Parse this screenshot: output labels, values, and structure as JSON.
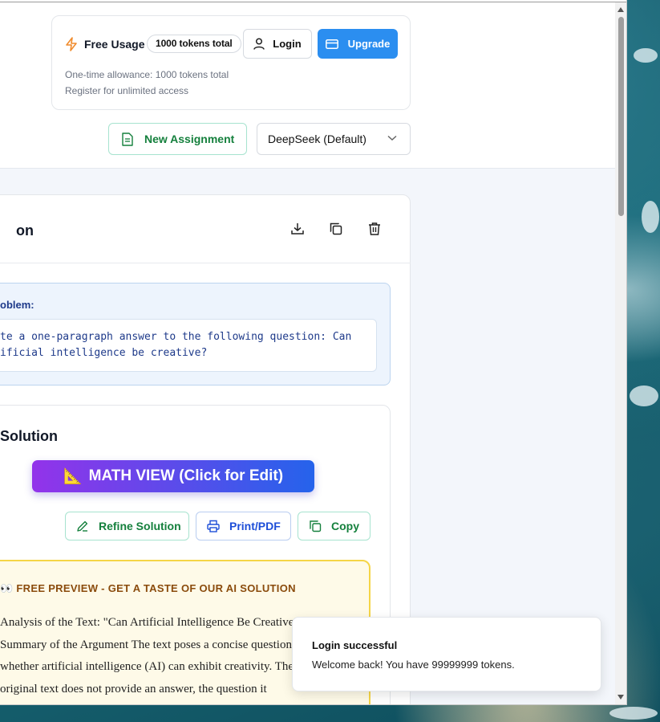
{
  "usage": {
    "title": "Free Usage",
    "token_pill": "1000 tokens total",
    "login_label": "Login",
    "upgrade_label": "Upgrade",
    "allowance_line": "One-time allowance: 1000 tokens total",
    "register_line": "Register for unlimited access"
  },
  "toolbar": {
    "new_assignment_label": "New Assignment",
    "model_selected": "DeepSeek (Default)"
  },
  "card": {
    "title_fragment": "on",
    "problem_label": "oblem:",
    "problem_text": "te a one-paragraph answer to the following question: Can\nificial intelligence be creative?"
  },
  "solution": {
    "title": "Solution",
    "math_view_label": "MATH VIEW (Click for Edit)",
    "math_view_emoji": "📐",
    "refine_label": "Refine Solution",
    "print_label": "Print/PDF",
    "copy_label": "Copy"
  },
  "preview": {
    "emoji": "👀",
    "heading": "FREE PREVIEW - GET A TASTE OF OUR AI SOLUTION",
    "body": "Analysis of the Text: \"Can Artificial Intelligence Be Creative?\"\nSummary of the Argument The text poses a concise question about\nwhether artificial intelligence (AI) can exhibit creativity. The\noriginal text does not provide an answer, the question it"
  },
  "toast": {
    "title": "Login successful",
    "message": "Welcome back! You have 99999999 tokens."
  },
  "colors": {
    "accent_blue": "#2b8ef0",
    "green": "#15803d",
    "preview_border": "#f5d547"
  }
}
